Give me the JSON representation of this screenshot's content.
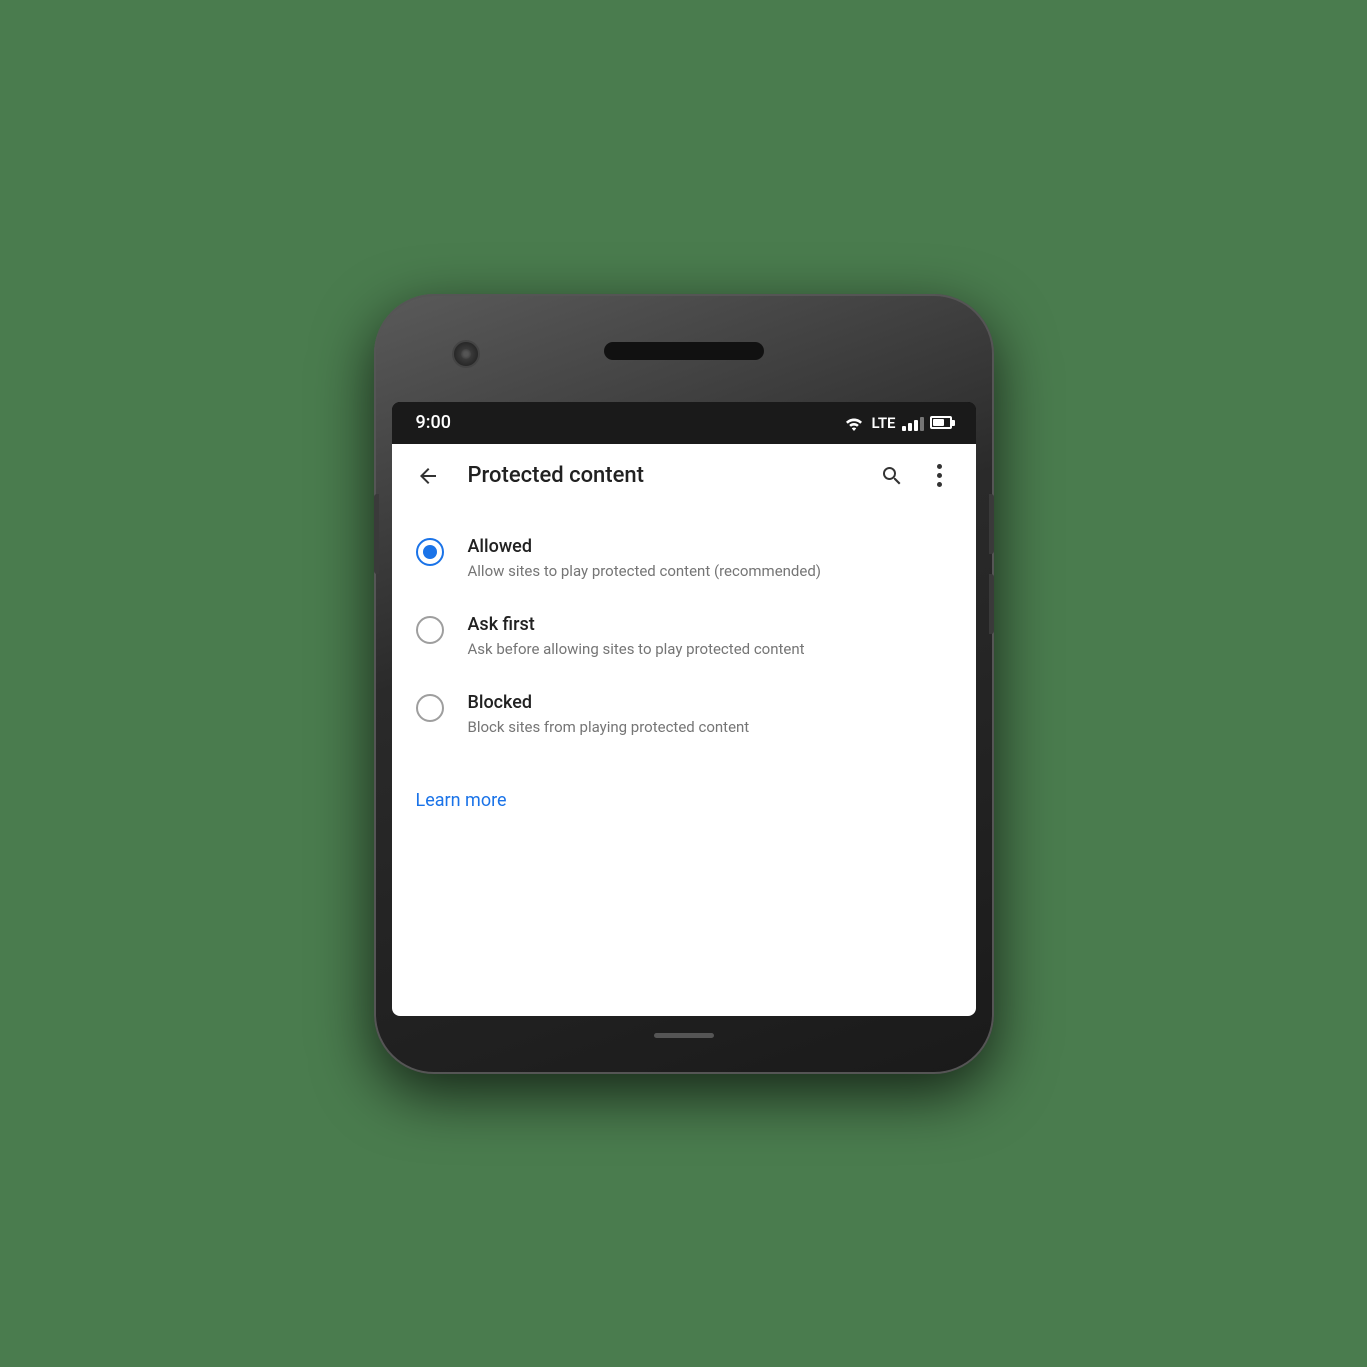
{
  "statusBar": {
    "time": "9:00",
    "lte": "LTE"
  },
  "appBar": {
    "title": "Protected content",
    "backLabel": "Back",
    "searchLabel": "Search",
    "moreLabel": "More options"
  },
  "options": [
    {
      "id": "allowed",
      "title": "Allowed",
      "description": "Allow sites to play protected content (recommended)",
      "selected": true
    },
    {
      "id": "ask-first",
      "title": "Ask first",
      "description": "Ask before allowing sites to play protected content",
      "selected": false
    },
    {
      "id": "blocked",
      "title": "Blocked",
      "description": "Block sites from playing protected content",
      "selected": false
    }
  ],
  "learnMore": {
    "label": "Learn more"
  }
}
